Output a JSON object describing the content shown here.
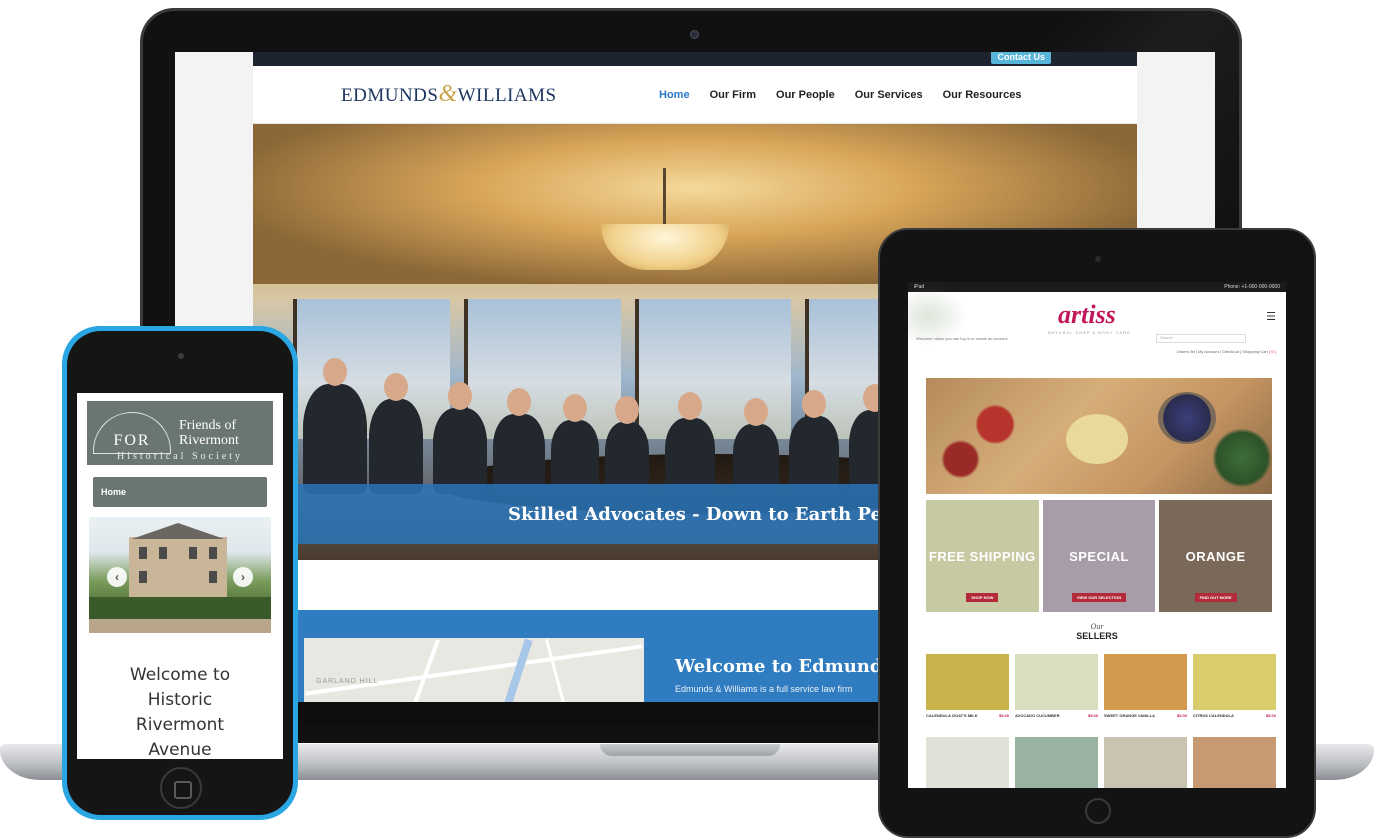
{
  "laptop": {
    "site": {
      "contact_label": "Contact Us",
      "logo_left": "EDMUNDS",
      "logo_amp": "&",
      "logo_right": "WILLIAMS",
      "nav": [
        "Home",
        "Our Firm",
        "Our People",
        "Our Services",
        "Our Resources"
      ],
      "active_nav": "Home",
      "hero_tagline": "Skilled Advocates - Down to Earth People",
      "map_label": "GARLAND HILL",
      "welcome_title": "Welcome to Edmunds & Williams",
      "welcome_text": "Edmunds & Williams is a full service law firm"
    }
  },
  "phone": {
    "site": {
      "logo_mark": "FOR",
      "title_line1": "Friends of",
      "title_line2": "Rivermont",
      "subtitle": "Historical Society",
      "nav_item": "Home",
      "prev_icon": "chevron-left-icon",
      "next_icon": "chevron-right-icon",
      "welcome": "Welcome to Historic Rivermont Avenue"
    }
  },
  "tablet": {
    "site": {
      "status_left": "iPad",
      "status_right": "Phone: +1-000-000-0000",
      "logo": "artiss",
      "logo_sub": "NATURAL SOAP & BODY CARE",
      "welcome": "Welcome visitor you can log in or create an account",
      "search_placeholder": "Search",
      "links": "Orders list | My Account | Checkout | Shopping Cart",
      "cart_count": "( 0 )",
      "promos": [
        {
          "title": "FREE SHIPPING",
          "button": "SHOP NOW",
          "bg": "#c7c9a3"
        },
        {
          "title": "SPECIAL",
          "button": "VIEW OUR SELECTION",
          "bg": "#a79ca7"
        },
        {
          "title": "ORANGE",
          "button": "FIND OUT MORE",
          "bg": "#7a6858"
        }
      ],
      "best_our": "Our",
      "best_title": "SELLERS",
      "products": [
        {
          "name": "CALENDULA GOAT'S MILK",
          "price": "$5.00",
          "color": "#c8b44a"
        },
        {
          "name": "AVOCADO CUCUMBER",
          "price": "$5.00",
          "color": "#d7dfbe"
        },
        {
          "name": "SWEET ORANGE VANILLA",
          "price": "$5.00",
          "color": "#d39a4f"
        },
        {
          "name": "CITRUS CALENDULA",
          "price": "$5.00",
          "color": "#d8cc6c"
        },
        {
          "name": "",
          "price": "",
          "color": "#dfe2d6"
        },
        {
          "name": "",
          "price": "",
          "color": "#9ab3a0"
        },
        {
          "name": "",
          "price": "",
          "color": "#c9c3b2"
        },
        {
          "name": "",
          "price": "",
          "color": "#c79a74"
        }
      ]
    }
  }
}
